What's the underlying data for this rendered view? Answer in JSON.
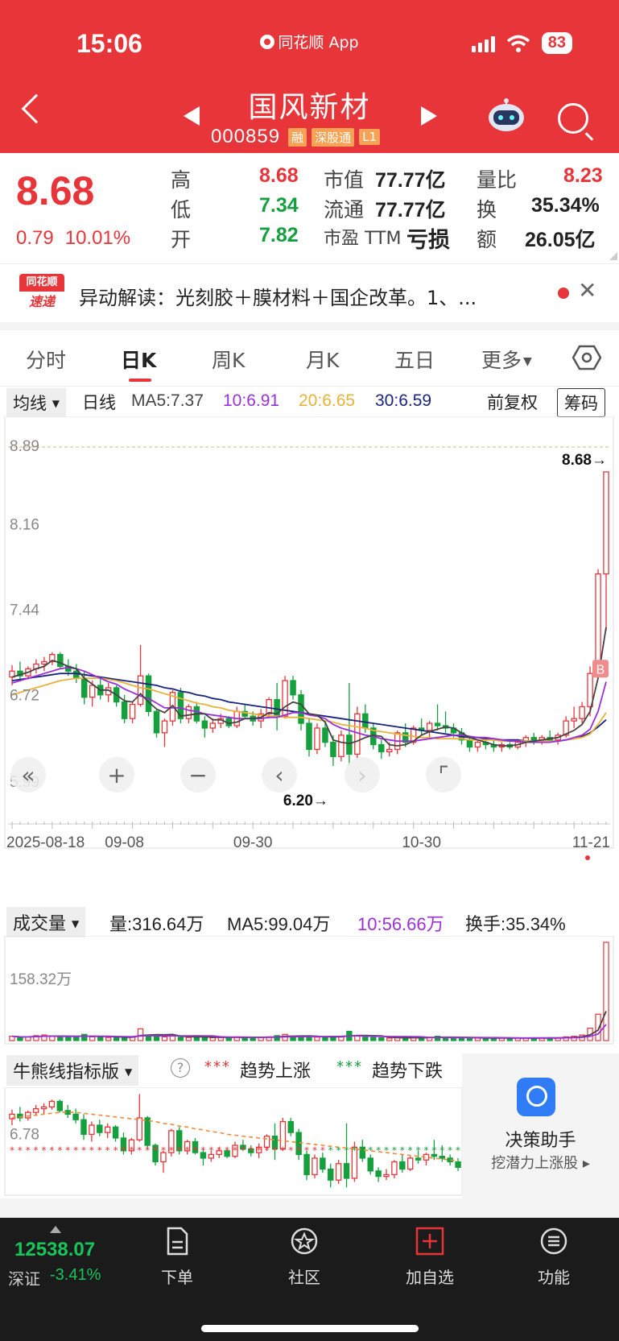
{
  "status": {
    "time": "15:06",
    "app": "同花顺 App",
    "battery": "83"
  },
  "header": {
    "stock_name": "国风新材",
    "stock_code": "000859",
    "tags": [
      "融",
      "深股通",
      "L1"
    ]
  },
  "quote": {
    "price": "8.68",
    "change": "0.79",
    "change_pct": "10.01%",
    "high_label": "高",
    "high": "8.68",
    "low_label": "低",
    "low": "7.34",
    "open_label": "开",
    "open": "7.82",
    "mcap_label": "市值",
    "mcap": "77.77亿",
    "float_label": "流通",
    "float": "77.77亿",
    "pe_label": "市盈 TTM",
    "pe": "亏损",
    "vr_label": "量比",
    "vr": "8.23",
    "turnover_label": "换",
    "turnover": "35.34%",
    "amount_label": "额",
    "amount": "26.05亿"
  },
  "news": {
    "logo_top": "同花顺",
    "logo_bottom": "速递",
    "text": "异动解读：光刻胶＋膜材料＋国企改革。1、..."
  },
  "tabs": [
    "分时",
    "日K",
    "周K",
    "月K",
    "五日",
    "更多"
  ],
  "chart_head": {
    "ma_type": "均线",
    "period": "日线",
    "ma5": "MA5:7.37",
    "ma10": "10:6.91",
    "ma20": "20:6.65",
    "ma30": "30:6.59",
    "adjust": "前复权",
    "chips": "筹码",
    "colors": {
      "ma5": "#444444",
      "ma10": "#9b30d9",
      "ma20": "#e8b23a",
      "ma30": "#1a237e"
    }
  },
  "kline": {
    "y_ticks": [
      "8.89",
      "8.16",
      "7.44",
      "6.72",
      "5.99"
    ],
    "max_marker": "8.68→",
    "min_marker": "6.20→",
    "x_labels": [
      "2025-08-18",
      "09-08",
      "09-30",
      "10-30",
      "11-21"
    ],
    "b_marker": "B"
  },
  "chart_data": {
    "type": "candlestick",
    "title": "",
    "xlabel": "",
    "ylabel": "",
    "ylim": [
      5.99,
      8.89
    ],
    "ohlc": [
      [
        6.95,
        7.05,
        6.88,
        7.0
      ],
      [
        7.0,
        7.08,
        6.92,
        6.96
      ],
      [
        6.96,
        7.04,
        6.93,
        7.02
      ],
      [
        7.02,
        7.1,
        6.98,
        7.06
      ],
      [
        7.06,
        7.12,
        7.0,
        7.08
      ],
      [
        7.08,
        7.16,
        7.05,
        7.14
      ],
      [
        7.14,
        7.16,
        7.02,
        7.04
      ],
      [
        7.04,
        7.1,
        6.96,
        7.0
      ],
      [
        7.0,
        7.06,
        6.9,
        6.94
      ],
      [
        6.94,
        7.0,
        6.72,
        6.78
      ],
      [
        6.78,
        6.92,
        6.7,
        6.88
      ],
      [
        6.88,
        6.94,
        6.76,
        6.8
      ],
      [
        6.8,
        6.9,
        6.74,
        6.86
      ],
      [
        6.86,
        6.88,
        6.7,
        6.74
      ],
      [
        6.74,
        6.8,
        6.56,
        6.6
      ],
      [
        6.6,
        6.74,
        6.56,
        6.72
      ],
      [
        6.72,
        7.22,
        6.7,
        6.96
      ],
      [
        6.96,
        6.98,
        6.62,
        6.66
      ],
      [
        6.66,
        6.68,
        6.44,
        6.48
      ],
      [
        6.48,
        6.6,
        6.36,
        6.58
      ],
      [
        6.58,
        6.84,
        6.54,
        6.82
      ],
      [
        6.82,
        6.86,
        6.56,
        6.6
      ],
      [
        6.6,
        6.72,
        6.56,
        6.7
      ],
      [
        6.7,
        6.74,
        6.56,
        6.58
      ],
      [
        6.58,
        6.62,
        6.44,
        6.52
      ],
      [
        6.52,
        6.6,
        6.48,
        6.56
      ],
      [
        6.56,
        6.64,
        6.52,
        6.6
      ],
      [
        6.6,
        6.62,
        6.52,
        6.54
      ],
      [
        6.54,
        6.7,
        6.52,
        6.66
      ],
      [
        6.66,
        6.72,
        6.6,
        6.62
      ],
      [
        6.62,
        6.66,
        6.54,
        6.58
      ],
      [
        6.58,
        6.68,
        6.52,
        6.64
      ],
      [
        6.64,
        6.78,
        6.6,
        6.76
      ],
      [
        6.76,
        6.9,
        6.5,
        6.62
      ],
      [
        6.62,
        6.96,
        6.6,
        6.92
      ],
      [
        6.92,
        6.96,
        6.76,
        6.8
      ],
      [
        6.8,
        6.84,
        6.5,
        6.56
      ],
      [
        6.56,
        6.6,
        6.28,
        6.34
      ],
      [
        6.34,
        6.56,
        6.3,
        6.52
      ],
      [
        6.52,
        6.58,
        6.36,
        6.4
      ],
      [
        6.4,
        6.46,
        6.2,
        6.28
      ],
      [
        6.28,
        6.5,
        6.24,
        6.46
      ],
      [
        6.46,
        6.9,
        6.2,
        6.3
      ],
      [
        6.3,
        6.7,
        6.26,
        6.64
      ],
      [
        6.64,
        6.72,
        6.48,
        6.52
      ],
      [
        6.52,
        6.56,
        6.34,
        6.38
      ],
      [
        6.38,
        6.42,
        6.26,
        6.32
      ],
      [
        6.32,
        6.4,
        6.28,
        6.34
      ],
      [
        6.34,
        6.5,
        6.3,
        6.48
      ],
      [
        6.48,
        6.56,
        6.36,
        6.4
      ],
      [
        6.4,
        6.54,
        6.38,
        6.52
      ],
      [
        6.52,
        6.6,
        6.46,
        6.5
      ],
      [
        6.5,
        6.58,
        6.44,
        6.56
      ],
      [
        6.56,
        6.72,
        6.5,
        6.54
      ],
      [
        6.54,
        6.66,
        6.48,
        6.52
      ],
      [
        6.52,
        6.56,
        6.44,
        6.48
      ],
      [
        6.48,
        6.52,
        6.38,
        6.42
      ],
      [
        6.42,
        6.44,
        6.32,
        6.36
      ],
      [
        6.36,
        6.42,
        6.32,
        6.4
      ],
      [
        6.4,
        6.44,
        6.34,
        6.38
      ],
      [
        6.38,
        6.42,
        6.32,
        6.36
      ],
      [
        6.36,
        6.4,
        6.32,
        6.38
      ],
      [
        6.38,
        6.4,
        6.34,
        6.36
      ],
      [
        6.36,
        6.42,
        6.34,
        6.4
      ],
      [
        6.4,
        6.46,
        6.36,
        6.44
      ],
      [
        6.44,
        6.48,
        6.38,
        6.42
      ],
      [
        6.42,
        6.46,
        6.38,
        6.44
      ],
      [
        6.44,
        6.5,
        6.4,
        6.42
      ],
      [
        6.42,
        6.48,
        6.38,
        6.46
      ],
      [
        6.46,
        6.62,
        6.44,
        6.58
      ],
      [
        6.58,
        6.7,
        6.52,
        6.6
      ],
      [
        6.6,
        6.74,
        6.56,
        6.7
      ],
      [
        6.7,
        7.04,
        6.62,
        6.98
      ],
      [
        6.98,
        7.86,
        6.96,
        7.82
      ],
      [
        7.82,
        8.68,
        7.34,
        8.68
      ]
    ],
    "ma5": [
      6.95,
      6.97,
      6.99,
      7.02,
      7.04,
      7.09,
      7.07,
      7.04,
      7.02,
      6.94,
      6.89,
      6.84,
      6.84,
      6.8,
      6.75,
      6.74,
      6.81,
      6.74,
      6.68,
      6.65,
      6.71,
      6.62,
      6.63,
      6.64,
      6.64,
      6.59,
      6.59,
      6.56,
      6.57,
      6.6,
      6.6,
      6.61,
      6.65,
      6.64,
      6.7,
      6.74,
      6.72,
      6.64,
      6.63,
      6.57,
      6.42,
      6.4,
      6.39,
      6.41,
      6.44,
      6.46,
      6.45,
      6.38,
      6.37,
      6.38,
      6.41,
      6.46,
      6.49,
      6.51,
      6.53,
      6.52,
      6.48,
      6.44,
      6.42,
      6.4,
      6.38,
      6.37,
      6.37,
      6.38,
      6.4,
      6.41,
      6.42,
      6.43,
      6.44,
      6.47,
      6.5,
      6.55,
      6.66,
      6.94,
      7.37
    ],
    "ma10": [
      6.9,
      6.92,
      6.94,
      6.96,
      6.98,
      7.0,
      7.02,
      7.03,
      7.02,
      7.0,
      6.97,
      6.94,
      6.91,
      6.89,
      6.85,
      6.82,
      6.79,
      6.77,
      6.73,
      6.69,
      6.69,
      6.69,
      6.67,
      6.66,
      6.64,
      6.63,
      6.62,
      6.61,
      6.6,
      6.6,
      6.6,
      6.6,
      6.61,
      6.61,
      6.63,
      6.65,
      6.65,
      6.63,
      6.62,
      6.6,
      6.55,
      6.52,
      6.5,
      6.48,
      6.46,
      6.45,
      6.43,
      6.42,
      6.41,
      6.41,
      6.41,
      6.42,
      6.43,
      6.44,
      6.45,
      6.46,
      6.46,
      6.45,
      6.44,
      6.44,
      6.43,
      6.42,
      6.41,
      6.41,
      6.4,
      6.4,
      6.4,
      6.4,
      6.41,
      6.42,
      6.44,
      6.46,
      6.51,
      6.66,
      6.91
    ],
    "ma20": [
      6.8,
      6.82,
      6.84,
      6.86,
      6.88,
      6.9,
      6.92,
      6.93,
      6.94,
      6.94,
      6.94,
      6.94,
      6.93,
      6.92,
      6.9,
      6.88,
      6.86,
      6.85,
      6.83,
      6.81,
      6.79,
      6.77,
      6.75,
      6.73,
      6.72,
      6.7,
      6.69,
      6.67,
      6.66,
      6.65,
      6.64,
      6.63,
      6.62,
      6.62,
      6.61,
      6.61,
      6.61,
      6.6,
      6.59,
      6.58,
      6.57,
      6.55,
      6.54,
      6.53,
      6.52,
      6.5,
      6.49,
      6.48,
      6.47,
      6.46,
      6.45,
      6.44,
      6.44,
      6.43,
      6.43,
      6.43,
      6.43,
      6.42,
      6.42,
      6.42,
      6.42,
      6.41,
      6.41,
      6.41,
      6.41,
      6.41,
      6.41,
      6.41,
      6.41,
      6.42,
      6.43,
      6.44,
      6.47,
      6.55,
      6.65
    ],
    "ma30": [
      6.92,
      6.93,
      6.94,
      6.95,
      6.96,
      6.97,
      6.98,
      6.98,
      6.98,
      6.97,
      6.96,
      6.95,
      6.94,
      6.93,
      6.92,
      6.91,
      6.9,
      6.89,
      6.88,
      6.86,
      6.85,
      6.83,
      6.82,
      6.8,
      6.79,
      6.77,
      6.76,
      6.74,
      6.73,
      6.72,
      6.71,
      6.7,
      6.69,
      6.68,
      6.67,
      6.66,
      6.65,
      6.64,
      6.63,
      6.62,
      6.61,
      6.6,
      6.59,
      6.58,
      6.57,
      6.56,
      6.55,
      6.54,
      6.53,
      6.52,
      6.51,
      6.5,
      6.49,
      6.48,
      6.47,
      6.46,
      6.45,
      6.44,
      6.44,
      6.43,
      6.43,
      6.42,
      6.42,
      6.42,
      6.41,
      6.41,
      6.41,
      6.41,
      6.41,
      6.42,
      6.43,
      6.45,
      6.48,
      6.53,
      6.59
    ],
    "volume": [
      14,
      10,
      12,
      16,
      18,
      15,
      12,
      11,
      14,
      20,
      12,
      11,
      10,
      9,
      13,
      12,
      38,
      18,
      14,
      12,
      16,
      11,
      10,
      12,
      11,
      9,
      10,
      10,
      12,
      10,
      11,
      10,
      12,
      16,
      20,
      14,
      12,
      13,
      11,
      10,
      14,
      12,
      30,
      16,
      11,
      10,
      9,
      8,
      9,
      10,
      9,
      10,
      10,
      14,
      11,
      9,
      9,
      8,
      8,
      8,
      8,
      8,
      8,
      8,
      8,
      9,
      9,
      9,
      8,
      12,
      14,
      18,
      40,
      85,
      316.64
    ],
    "volume_ylabel": "158.32万"
  },
  "volume_head": {
    "label": "成交量",
    "vol": "量:316.64万",
    "ma5": "MA5:99.04万",
    "ma10": "10:56.66万",
    "turnover": "换手:35.34%"
  },
  "bull_head": {
    "label": "牛熊线指标版",
    "help": "?",
    "up": "趋势上涨",
    "down": "趋势下跌",
    "ytick": "6.78"
  },
  "assist": {
    "title": "决策助手",
    "sub": "挖潜力上涨股 ▸"
  },
  "bottom": {
    "index_value": "12538.07",
    "index_name": "深证",
    "index_change": "-3.41%",
    "nav": [
      "下单",
      "社区",
      "加自选",
      "功能"
    ]
  }
}
